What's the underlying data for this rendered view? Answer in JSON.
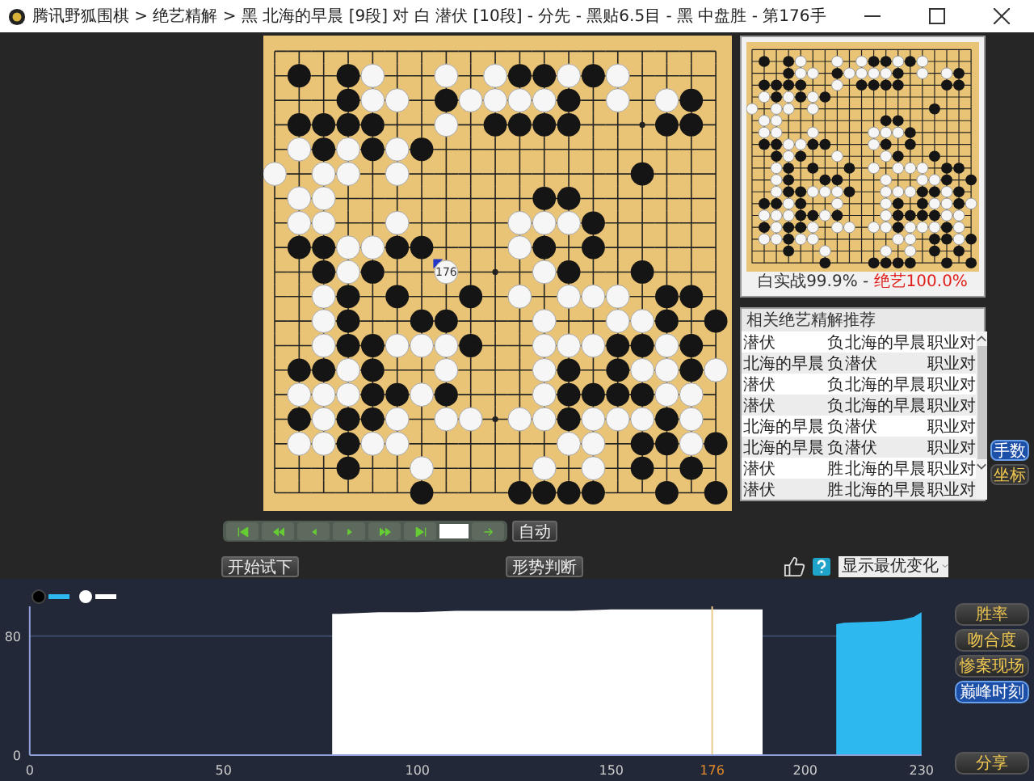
{
  "window": {
    "title": "腾讯野狐围棋 > 绝艺精解 > 黑 北海的早晨 [9段] 对 白 潜伏 [10段] - 分先 - 黑贴6.5目 - 黑 中盘胜 - 第176手"
  },
  "board": {
    "last_move_label": "176",
    "rows": [
      [
        {
          "stone": false
        },
        {
          "stone": false
        },
        {
          "stone": false
        },
        {
          "stone": false
        },
        {
          "stone": false
        },
        {
          "stone": false
        },
        {
          "stone": false
        },
        {
          "stone": false
        },
        {
          "stone": false
        },
        {
          "stone": false
        },
        {
          "stone": false
        },
        {
          "stone": false
        },
        {
          "stone": false
        },
        {
          "stone": false
        },
        {
          "stone": false
        },
        {
          "stone": false
        },
        {
          "stone": false
        },
        {
          "stone": false
        },
        {
          "stone": false
        }
      ],
      [
        {
          "stone": false
        },
        {
          "stone": true,
          "black": true
        },
        {
          "stone": false
        },
        {
          "stone": true,
          "black": true
        },
        {
          "stone": true,
          "black": false
        },
        {
          "stone": false
        },
        {
          "stone": false
        },
        {
          "stone": true,
          "black": false
        },
        {
          "stone": false
        },
        {
          "stone": true,
          "black": false
        },
        {
          "stone": true,
          "black": true
        },
        {
          "stone": true,
          "black": true
        },
        {
          "stone": true,
          "black": false
        },
        {
          "stone": true,
          "black": true
        },
        {
          "stone": true,
          "black": false
        },
        {
          "stone": false
        },
        {
          "stone": false
        },
        {
          "stone": false
        },
        {
          "stone": false
        }
      ],
      [
        {
          "stone": false
        },
        {
          "stone": false
        },
        {
          "stone": false
        },
        {
          "stone": true,
          "black": true
        },
        {
          "stone": true,
          "black": false
        },
        {
          "stone": true,
          "black": false
        },
        {
          "stone": false
        },
        {
          "stone": true,
          "black": true
        },
        {
          "stone": true,
          "black": false
        },
        {
          "stone": true,
          "black": false
        },
        {
          "stone": true,
          "black": false
        },
        {
          "stone": true,
          "black": false
        },
        {
          "stone": true,
          "black": true
        },
        {
          "stone": false
        },
        {
          "stone": true,
          "black": false
        },
        {
          "stone": false
        },
        {
          "stone": true,
          "black": false
        },
        {
          "stone": true,
          "black": true
        },
        {
          "stone": false
        }
      ],
      [
        {
          "stone": false
        },
        {
          "stone": true,
          "black": true
        },
        {
          "stone": true,
          "black": true
        },
        {
          "stone": true,
          "black": true
        },
        {
          "stone": true,
          "black": true
        },
        {
          "stone": false
        },
        {
          "stone": false
        },
        {
          "stone": true,
          "black": false
        },
        {
          "stone": false
        },
        {
          "stone": true,
          "black": true
        },
        {
          "stone": true,
          "black": true
        },
        {
          "stone": true,
          "black": true
        },
        {
          "stone": true,
          "black": true
        },
        {
          "stone": false
        },
        {
          "stone": false
        },
        {
          "stone": false
        },
        {
          "stone": true,
          "black": true
        },
        {
          "stone": true,
          "black": true
        },
        {
          "stone": false
        }
      ],
      [
        {
          "stone": false
        },
        {
          "stone": true,
          "black": false
        },
        {
          "stone": true,
          "black": true
        },
        {
          "stone": true,
          "black": false
        },
        {
          "stone": true,
          "black": true
        },
        {
          "stone": true,
          "black": false
        },
        {
          "stone": true,
          "black": true
        },
        {
          "stone": false
        },
        {
          "stone": false
        },
        {
          "stone": false
        },
        {
          "stone": false
        },
        {
          "stone": false
        },
        {
          "stone": false
        },
        {
          "stone": false
        },
        {
          "stone": false
        },
        {
          "stone": false
        },
        {
          "stone": false
        },
        {
          "stone": false
        },
        {
          "stone": false
        }
      ],
      [
        {
          "stone": true,
          "black": false
        },
        {
          "stone": false
        },
        {
          "stone": true,
          "black": false
        },
        {
          "stone": true,
          "black": false
        },
        {
          "stone": false
        },
        {
          "stone": true,
          "black": false
        },
        {
          "stone": false
        },
        {
          "stone": false
        },
        {
          "stone": false
        },
        {
          "stone": false
        },
        {
          "stone": false
        },
        {
          "stone": false
        },
        {
          "stone": false
        },
        {
          "stone": false
        },
        {
          "stone": false
        },
        {
          "stone": true,
          "black": true
        },
        {
          "stone": false
        },
        {
          "stone": false
        },
        {
          "stone": false
        }
      ],
      [
        {
          "stone": false
        },
        {
          "stone": true,
          "black": false
        },
        {
          "stone": true,
          "black": false
        },
        {
          "stone": false
        },
        {
          "stone": false
        },
        {
          "stone": false
        },
        {
          "stone": false
        },
        {
          "stone": false
        },
        {
          "stone": false
        },
        {
          "stone": false
        },
        {
          "stone": false
        },
        {
          "stone": true,
          "black": true
        },
        {
          "stone": true,
          "black": true
        },
        {
          "stone": false
        },
        {
          "stone": false
        },
        {
          "stone": false
        },
        {
          "stone": false
        },
        {
          "stone": false
        },
        {
          "stone": false
        }
      ],
      [
        {
          "stone": false
        },
        {
          "stone": true,
          "black": false
        },
        {
          "stone": true,
          "black": false
        },
        {
          "stone": false
        },
        {
          "stone": false
        },
        {
          "stone": true,
          "black": false
        },
        {
          "stone": false
        },
        {
          "stone": false
        },
        {
          "stone": false
        },
        {
          "stone": false
        },
        {
          "stone": true,
          "black": false
        },
        {
          "stone": true,
          "black": false
        },
        {
          "stone": true,
          "black": false
        },
        {
          "stone": true,
          "black": true
        },
        {
          "stone": false
        },
        {
          "stone": false
        },
        {
          "stone": false
        },
        {
          "stone": false
        },
        {
          "stone": false
        }
      ],
      [
        {
          "stone": false
        },
        {
          "stone": true,
          "black": true
        },
        {
          "stone": true,
          "black": true
        },
        {
          "stone": true,
          "black": false
        },
        {
          "stone": true,
          "black": false
        },
        {
          "stone": true,
          "black": true
        },
        {
          "stone": true,
          "black": true
        },
        {
          "stone": false
        },
        {
          "stone": false
        },
        {
          "stone": false
        },
        {
          "stone": true,
          "black": false
        },
        {
          "stone": true,
          "black": true
        },
        {
          "stone": false
        },
        {
          "stone": true,
          "black": true
        },
        {
          "stone": false
        },
        {
          "stone": false
        },
        {
          "stone": false
        },
        {
          "stone": false
        },
        {
          "stone": false
        }
      ],
      [
        {
          "stone": false
        },
        {
          "stone": false
        },
        {
          "stone": true,
          "black": true
        },
        {
          "stone": true,
          "black": false
        },
        {
          "stone": true,
          "black": true
        },
        {
          "stone": false
        },
        {
          "stone": false
        },
        {
          "stone": true,
          "black": false,
          "last_move": true
        },
        {
          "stone": false
        },
        {
          "stone": false
        },
        {
          "stone": false
        },
        {
          "stone": true,
          "black": false
        },
        {
          "stone": true,
          "black": true
        },
        {
          "stone": false
        },
        {
          "stone": false
        },
        {
          "stone": true,
          "black": true
        },
        {
          "stone": false
        },
        {
          "stone": false
        },
        {
          "stone": false
        }
      ],
      [
        {
          "stone": false
        },
        {
          "stone": false
        },
        {
          "stone": true,
          "black": false
        },
        {
          "stone": true,
          "black": true
        },
        {
          "stone": false
        },
        {
          "stone": true,
          "black": true
        },
        {
          "stone": false
        },
        {
          "stone": false
        },
        {
          "stone": true,
          "black": true
        },
        {
          "stone": false
        },
        {
          "stone": true,
          "black": false
        },
        {
          "stone": false
        },
        {
          "stone": true,
          "black": false
        },
        {
          "stone": true,
          "black": false
        },
        {
          "stone": true,
          "black": false
        },
        {
          "stone": false
        },
        {
          "stone": true,
          "black": true
        },
        {
          "stone": true,
          "black": true
        },
        {
          "stone": false
        }
      ],
      [
        {
          "stone": false
        },
        {
          "stone": false
        },
        {
          "stone": true,
          "black": false
        },
        {
          "stone": true,
          "black": true
        },
        {
          "stone": false
        },
        {
          "stone": false
        },
        {
          "stone": true,
          "black": true
        },
        {
          "stone": true,
          "black": true
        },
        {
          "stone": false
        },
        {
          "stone": false
        },
        {
          "stone": false
        },
        {
          "stone": true,
          "black": false
        },
        {
          "stone": false
        },
        {
          "stone": false
        },
        {
          "stone": true,
          "black": false
        },
        {
          "stone": true,
          "black": false
        },
        {
          "stone": true,
          "black": true
        },
        {
          "stone": false
        },
        {
          "stone": true,
          "black": true
        }
      ],
      [
        {
          "stone": false
        },
        {
          "stone": false
        },
        {
          "stone": true,
          "black": false
        },
        {
          "stone": true,
          "black": true
        },
        {
          "stone": true,
          "black": true
        },
        {
          "stone": true,
          "black": false
        },
        {
          "stone": true,
          "black": false
        },
        {
          "stone": true,
          "black": false
        },
        {
          "stone": true,
          "black": true
        },
        {
          "stone": false
        },
        {
          "stone": false
        },
        {
          "stone": true,
          "black": false
        },
        {
          "stone": true,
          "black": false
        },
        {
          "stone": true,
          "black": false
        },
        {
          "stone": true,
          "black": true
        },
        {
          "stone": true,
          "black": true
        },
        {
          "stone": true,
          "black": false
        },
        {
          "stone": true,
          "black": true
        },
        {
          "stone": false
        }
      ],
      [
        {
          "stone": false
        },
        {
          "stone": true,
          "black": true
        },
        {
          "stone": true,
          "black": true
        },
        {
          "stone": true,
          "black": false
        },
        {
          "stone": true,
          "black": true
        },
        {
          "stone": false
        },
        {
          "stone": false
        },
        {
          "stone": true,
          "black": false
        },
        {
          "stone": false
        },
        {
          "stone": false
        },
        {
          "stone": false
        },
        {
          "stone": true,
          "black": false
        },
        {
          "stone": true,
          "black": true
        },
        {
          "stone": false
        },
        {
          "stone": true,
          "black": true
        },
        {
          "stone": true,
          "black": false
        },
        {
          "stone": true,
          "black": false
        },
        {
          "stone": true,
          "black": true
        },
        {
          "stone": true,
          "black": false
        }
      ],
      [
        {
          "stone": false
        },
        {
          "stone": true,
          "black": false
        },
        {
          "stone": true,
          "black": false
        },
        {
          "stone": true,
          "black": false
        },
        {
          "stone": true,
          "black": true
        },
        {
          "stone": true,
          "black": true
        },
        {
          "stone": true,
          "black": false
        },
        {
          "stone": true,
          "black": true
        },
        {
          "stone": false
        },
        {
          "stone": false
        },
        {
          "stone": false
        },
        {
          "stone": true,
          "black": false
        },
        {
          "stone": true,
          "black": true
        },
        {
          "stone": true,
          "black": true
        },
        {
          "stone": true,
          "black": true
        },
        {
          "stone": true,
          "black": true
        },
        {
          "stone": true,
          "black": false
        },
        {
          "stone": true,
          "black": false
        },
        {
          "stone": false
        }
      ],
      [
        {
          "stone": false
        },
        {
          "stone": true,
          "black": true
        },
        {
          "stone": true,
          "black": false
        },
        {
          "stone": true,
          "black": true
        },
        {
          "stone": true,
          "black": true
        },
        {
          "stone": true,
          "black": false
        },
        {
          "stone": false
        },
        {
          "stone": true,
          "black": false
        },
        {
          "stone": true,
          "black": false
        },
        {
          "stone": false
        },
        {
          "stone": true,
          "black": false
        },
        {
          "stone": true,
          "black": false
        },
        {
          "stone": true,
          "black": true
        },
        {
          "stone": true,
          "black": false
        },
        {
          "stone": true,
          "black": false
        },
        {
          "stone": true,
          "black": false
        },
        {
          "stone": true,
          "black": true
        },
        {
          "stone": true,
          "black": false
        },
        {
          "stone": false
        }
      ],
      [
        {
          "stone": false
        },
        {
          "stone": true,
          "black": false
        },
        {
          "stone": true,
          "black": false
        },
        {
          "stone": true,
          "black": true
        },
        {
          "stone": true,
          "black": false
        },
        {
          "stone": true,
          "black": false
        },
        {
          "stone": false
        },
        {
          "stone": false
        },
        {
          "stone": false
        },
        {
          "stone": false
        },
        {
          "stone": false
        },
        {
          "stone": false
        },
        {
          "stone": true,
          "black": false
        },
        {
          "stone": true,
          "black": false
        },
        {
          "stone": false
        },
        {
          "stone": true,
          "black": true
        },
        {
          "stone": true,
          "black": true
        },
        {
          "stone": true,
          "black": false
        },
        {
          "stone": true,
          "black": true
        }
      ],
      [
        {
          "stone": false
        },
        {
          "stone": false
        },
        {
          "stone": false
        },
        {
          "stone": true,
          "black": true
        },
        {
          "stone": false
        },
        {
          "stone": false
        },
        {
          "stone": true,
          "black": false
        },
        {
          "stone": false
        },
        {
          "stone": false
        },
        {
          "stone": false
        },
        {
          "stone": false
        },
        {
          "stone": true,
          "black": false
        },
        {
          "stone": false
        },
        {
          "stone": true,
          "black": false
        },
        {
          "stone": false
        },
        {
          "stone": true,
          "black": true
        },
        {
          "stone": false
        },
        {
          "stone": true,
          "black": true
        },
        {
          "stone": false
        }
      ],
      [
        {
          "stone": false
        },
        {
          "stone": false
        },
        {
          "stone": false
        },
        {
          "stone": false
        },
        {
          "stone": false
        },
        {
          "stone": false
        },
        {
          "stone": true,
          "black": true
        },
        {
          "stone": false
        },
        {
          "stone": false
        },
        {
          "stone": false
        },
        {
          "stone": true,
          "black": true
        },
        {
          "stone": true,
          "black": true
        },
        {
          "stone": true,
          "black": true
        },
        {
          "stone": true,
          "black": true
        },
        {
          "stone": false
        },
        {
          "stone": false
        },
        {
          "stone": true,
          "black": true
        },
        {
          "stone": false
        },
        {
          "stone": true,
          "black": true
        }
      ]
    ]
  },
  "win_rate": {
    "actual": "白实战99.9%",
    "separator": " - ",
    "ai": "绝艺100.0%"
  },
  "recommendations": {
    "title": "相关绝艺精解推荐",
    "rows": [
      [
        "潜伏",
        "负",
        "北海的早晨",
        "职业对"
      ],
      [
        "北海的早晨",
        "负",
        "潜伏",
        "职业对"
      ],
      [
        "潜伏",
        "负",
        "北海的早晨",
        "职业对"
      ],
      [
        "潜伏",
        "负",
        "北海的早晨",
        "职业对"
      ],
      [
        "北海的早晨",
        "负",
        "潜伏",
        "职业对"
      ],
      [
        "北海的早晨",
        "负",
        "潜伏",
        "职业对"
      ],
      [
        "潜伏",
        "胜",
        "北海的早晨",
        "职业对"
      ],
      [
        "潜伏",
        "胜",
        "北海的早晨",
        "职业对"
      ]
    ]
  },
  "side_tabs": [
    {
      "label": "手数",
      "selected": true
    },
    {
      "label": "坐标",
      "selected": false
    }
  ],
  "auto_button": "自动",
  "try_button": "开始试下",
  "judge_button": "形势判断",
  "variation_select": "显示最优变化",
  "chart_tabs": [
    {
      "label": "胜率",
      "selected": false
    },
    {
      "label": "吻合度",
      "selected": false
    },
    {
      "label": "惨案现场",
      "selected": false
    },
    {
      "label": "巅峰时刻",
      "selected": true
    }
  ],
  "share_button": "分享",
  "chart_data": {
    "type": "area",
    "x": [
      78,
      80,
      90,
      100,
      110,
      120,
      130,
      140,
      150,
      160,
      170,
      180,
      189,
      208,
      210,
      220,
      225,
      228,
      230
    ],
    "xlim": [
      0,
      230
    ],
    "ylim": [
      0,
      100
    ],
    "xticks": [
      0,
      50,
      100,
      150,
      {
        "value": 176,
        "label": "176"
      },
      200,
      230
    ],
    "yticks": [
      0,
      80
    ],
    "series": [
      {
        "color": "#2eb8f0",
        "values": [
          null,
          null,
          null,
          null,
          null,
          null,
          null,
          null,
          null,
          null,
          null,
          null,
          null,
          88,
          89,
          90,
          91,
          93,
          96
        ]
      },
      {
        "color": "#ffffff",
        "values": [
          95,
          95,
          96,
          96,
          97,
          97,
          97,
          97,
          98,
          98,
          98,
          98,
          98,
          null,
          null,
          null,
          null,
          null,
          null
        ]
      }
    ],
    "ref_lines": [
      {
        "axis": "y",
        "value": 80
      },
      {
        "axis": "x",
        "value": 176
      }
    ]
  }
}
